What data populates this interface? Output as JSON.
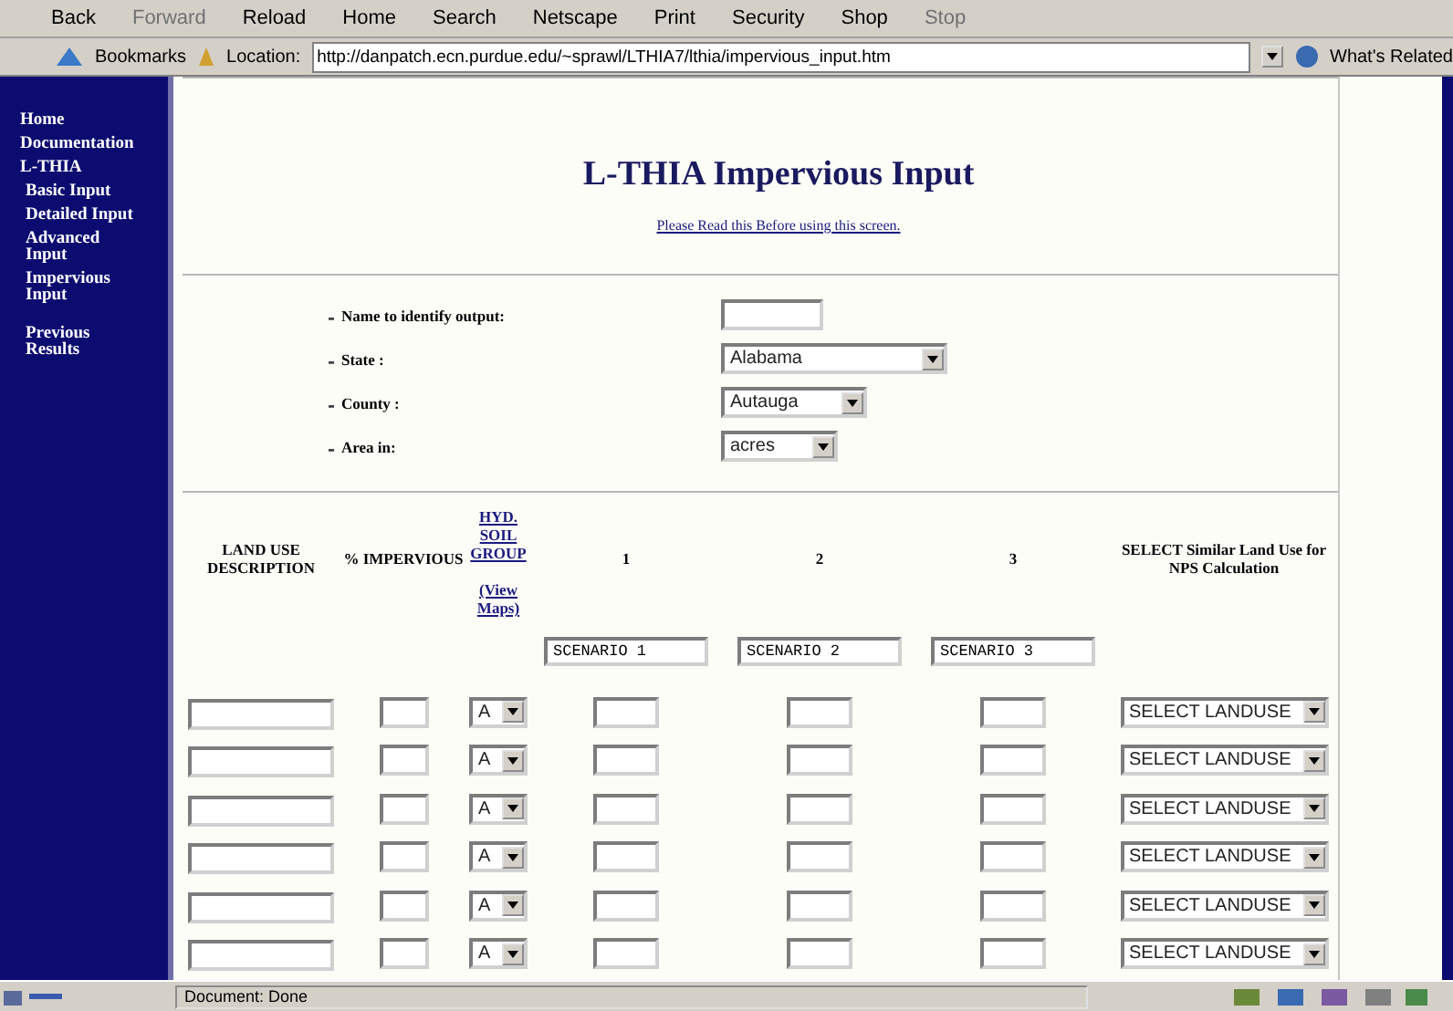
{
  "toolbar": [
    {
      "label": "Back",
      "disabled": false
    },
    {
      "label": "Forward",
      "disabled": true
    },
    {
      "label": "Reload",
      "disabled": false
    },
    {
      "label": "Home",
      "disabled": false
    },
    {
      "label": "Search",
      "disabled": false
    },
    {
      "label": "Netscape",
      "disabled": false
    },
    {
      "label": "Print",
      "disabled": false
    },
    {
      "label": "Security",
      "disabled": false
    },
    {
      "label": "Shop",
      "disabled": false
    },
    {
      "label": "Stop",
      "disabled": true
    }
  ],
  "location_bar": {
    "bookmarks": "Bookmarks",
    "location_label": "Location:",
    "url": "http://danpatch.ecn.purdue.edu/~sprawl/LTHIA7/lthia/impervious_input.htm",
    "whats_related": "What's Related"
  },
  "sidebar": {
    "items": [
      {
        "label": "Home"
      },
      {
        "label": "Documentation"
      },
      {
        "label": "L-THIA",
        "children": [
          {
            "label": "Basic Input"
          },
          {
            "label": "Detailed Input"
          },
          {
            "label": "Advanced Input"
          },
          {
            "label": "Impervious Input"
          },
          {
            "label": "Previous Results"
          }
        ]
      }
    ]
  },
  "page": {
    "title": "L-THIA Impervious Input",
    "notice_link": "Please Read this Before using this screen.",
    "form": [
      {
        "kind": "text",
        "label": "Name to identify output:"
      },
      {
        "kind": "select",
        "label": "State :",
        "value": "Alabama"
      },
      {
        "kind": "select",
        "label": "County :",
        "value": "Autauga"
      },
      {
        "kind": "select",
        "label": "Area in:",
        "value": "acres"
      }
    ],
    "table": {
      "columns": [
        {
          "kind": "text",
          "label": "LAND USE DESCRIPTION"
        },
        {
          "kind": "text",
          "label": "% IMPERVIOUS"
        },
        {
          "kind": "link",
          "label": "HYD. SOIL GROUP",
          "link2": "(View Maps)"
        },
        {
          "kind": "text",
          "label": "1"
        },
        {
          "kind": "text",
          "label": "2"
        },
        {
          "kind": "text",
          "label": "3"
        },
        {
          "kind": "text",
          "label": "SELECT Similar Land Use for NPS Calculation"
        }
      ],
      "scenario_names": [
        "SCENARIO 1",
        "SCENARIO 2",
        "SCENARIO 3"
      ],
      "rows": [
        {
          "soil_group": "A",
          "landuse": "SELECT LANDUSE"
        },
        {
          "soil_group": "A",
          "landuse": "SELECT LANDUSE"
        },
        {
          "soil_group": "A",
          "landuse": "SELECT LANDUSE"
        },
        {
          "soil_group": "A",
          "landuse": "SELECT LANDUSE"
        },
        {
          "soil_group": "A",
          "landuse": "SELECT LANDUSE"
        },
        {
          "soil_group": "A",
          "landuse": "SELECT LANDUSE"
        }
      ]
    }
  },
  "status_bar": {
    "text": "Document: Done"
  }
}
